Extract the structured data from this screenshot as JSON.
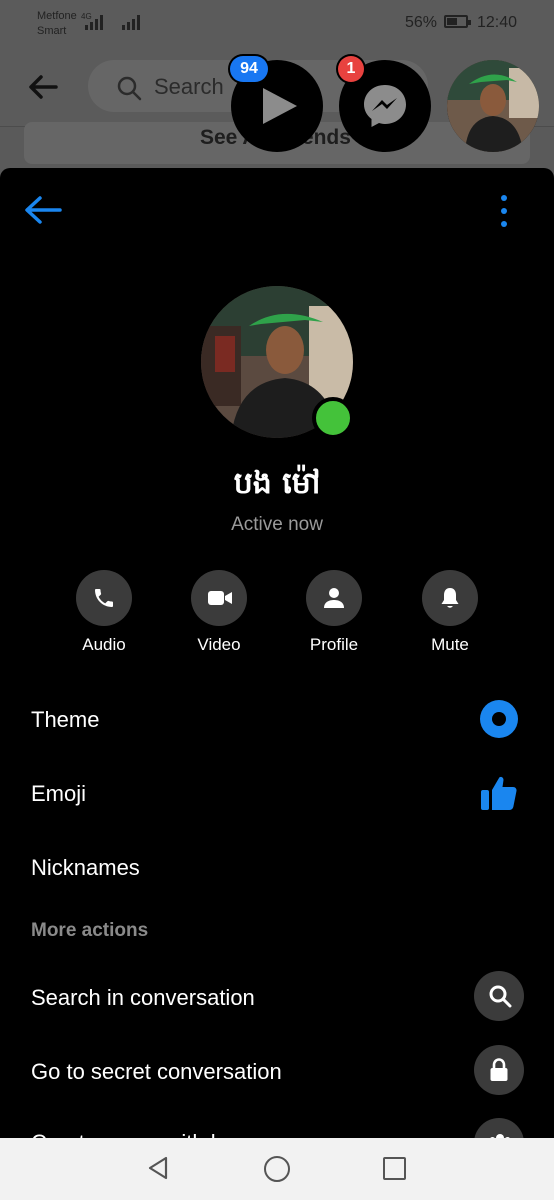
{
  "status_bar": {
    "carrier_1": "Metfone",
    "carrier_2": "Smart",
    "network_type": "4G",
    "battery_percent": "56%",
    "battery_level": 0.56,
    "time": "12:40"
  },
  "background_app": {
    "search_placeholder": "Search",
    "see_friends_label": "See All Friends"
  },
  "chat_heads": {
    "video_badge": "94",
    "messenger_badge": "1"
  },
  "profile": {
    "name": "បង ម៉ៅ",
    "status": "Active now"
  },
  "quick_actions": [
    {
      "label": "Audio",
      "icon": "phone-icon"
    },
    {
      "label": "Video",
      "icon": "video-camera-icon"
    },
    {
      "label": "Profile",
      "icon": "person-icon"
    },
    {
      "label": "Mute",
      "icon": "bell-icon"
    }
  ],
  "settings": {
    "theme_label": "Theme",
    "emoji_label": "Emoji",
    "nicknames_label": "Nicknames",
    "more_actions_header": "More actions",
    "search_label": "Search in conversation",
    "secret_label": "Go to secret conversation",
    "group_label": "Create group with bong"
  },
  "colors": {
    "accent": "#1a86ef",
    "online": "#44c23a",
    "badge_blue": "#1877f2",
    "badge_red": "#e8423f",
    "sheet_background": "#000000"
  }
}
